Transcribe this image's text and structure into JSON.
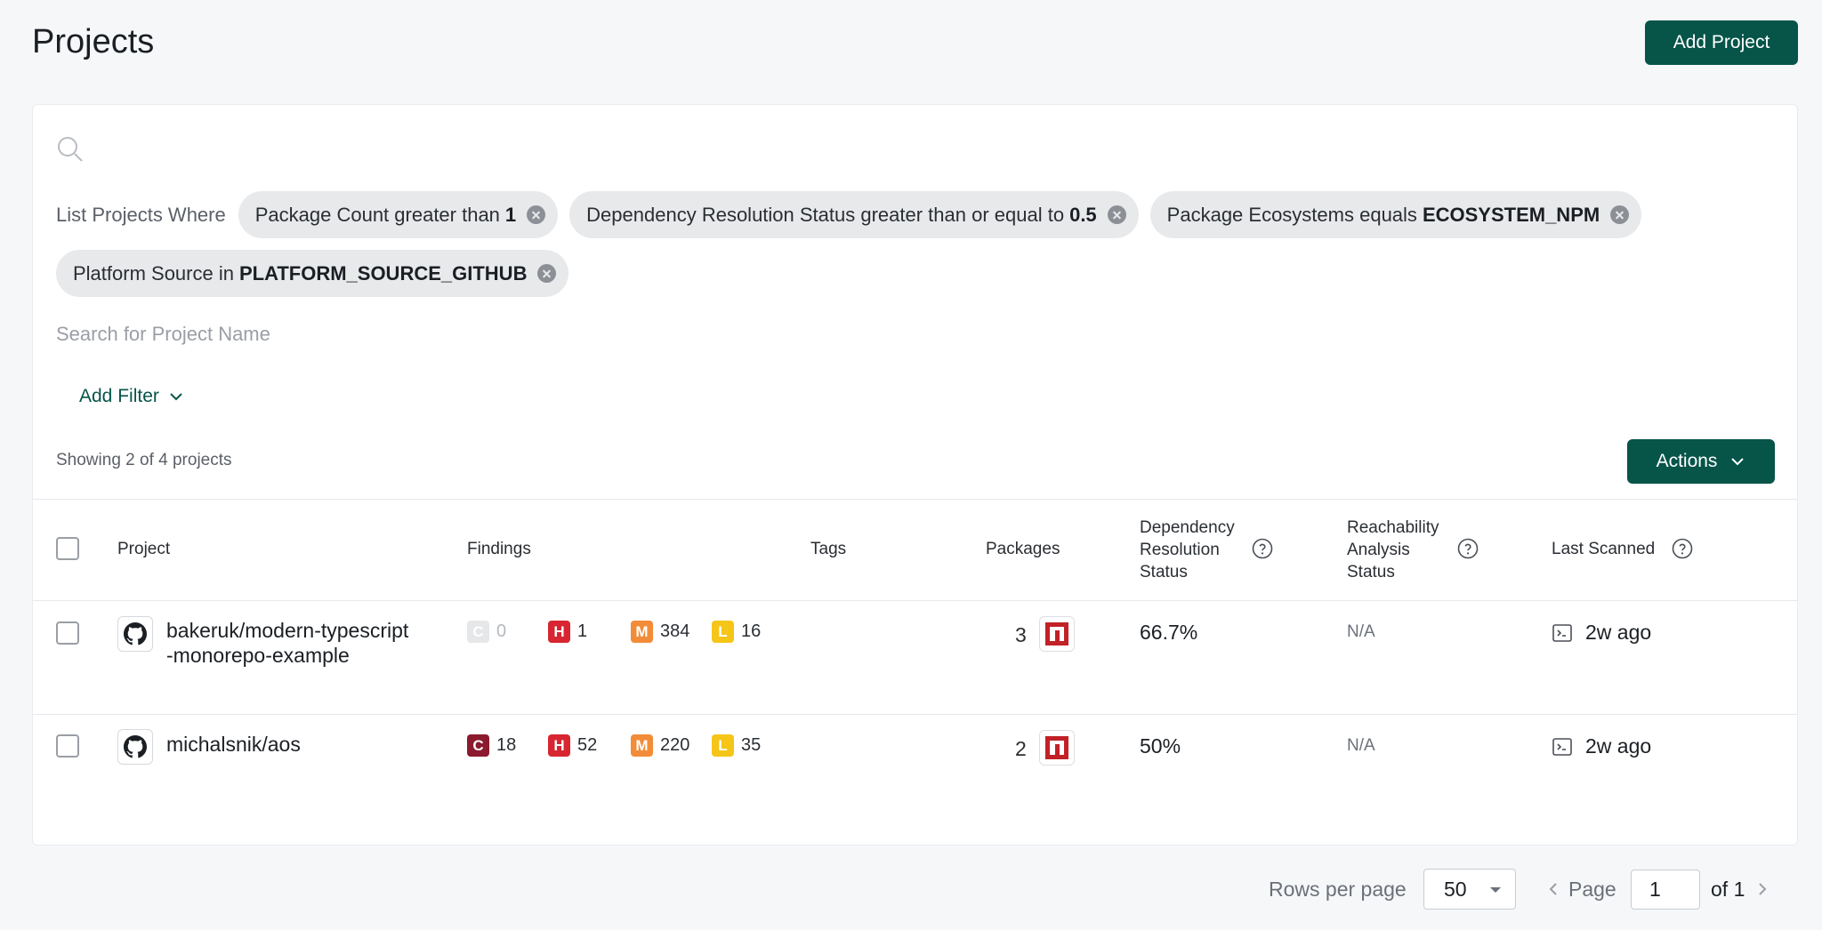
{
  "header": {
    "title": "Projects",
    "add_project_label": "Add Project"
  },
  "filters": {
    "label": "List Projects Where",
    "chips": [
      {
        "text": "Package Count greater than",
        "value": "1"
      },
      {
        "text": "Dependency Resolution Status greater than or equal to",
        "value": "0.5"
      },
      {
        "text": "Package Ecosystems equals",
        "value": "ECOSYSTEM_NPM"
      },
      {
        "text": "Platform Source in",
        "value": "PLATFORM_SOURCE_GITHUB"
      }
    ],
    "search_placeholder": "Search for Project Name",
    "add_filter_label": "Add Filter"
  },
  "summary": {
    "showing": "Showing 2 of 4 projects",
    "actions_label": "Actions"
  },
  "table": {
    "headers": {
      "project": "Project",
      "findings": "Findings",
      "tags": "Tags",
      "packages": "Packages",
      "dep_line1": "Dependency",
      "dep_line2": "Resolution",
      "dep_line3": "Status",
      "reach_line1": "Reachability",
      "reach_line2": "Analysis",
      "reach_line3": "Status",
      "last_scanned": "Last Scanned"
    },
    "rows": [
      {
        "name_line1": "bakeruk/modern-typescript",
        "name_line2": "-monorepo-example",
        "findings": {
          "c_label": "C",
          "c": "0",
          "h_label": "H",
          "h": "1",
          "m_label": "M",
          "m": "384",
          "l_label": "L",
          "l": "16"
        },
        "packages": "3",
        "dependency_status": "66.7%",
        "reachability": "N/A",
        "last_scanned": "2w ago"
      },
      {
        "name_line1": "michalsnik/aos",
        "name_line2": "",
        "findings": {
          "c_label": "C",
          "c": "18",
          "h_label": "H",
          "h": "52",
          "m_label": "M",
          "m": "220",
          "l_label": "L",
          "l": "35"
        },
        "packages": "2",
        "dependency_status": "50%",
        "reachability": "N/A",
        "last_scanned": "2w ago"
      }
    ]
  },
  "pagination": {
    "rows_label": "Rows per page",
    "rows_value": "50",
    "page_label": "Page",
    "page_value": "1",
    "of_label": "of 1"
  },
  "colors": {
    "primary": "#075449",
    "critical": "#8b1a2e",
    "high": "#d72631",
    "medium": "#f28c38",
    "low": "#f5c518"
  },
  "icons": [
    "search-icon",
    "close-icon",
    "chevron-down-icon",
    "help-icon",
    "github-icon",
    "npm-icon",
    "terminal-icon",
    "chevron-left-icon",
    "chevron-right-icon"
  ]
}
